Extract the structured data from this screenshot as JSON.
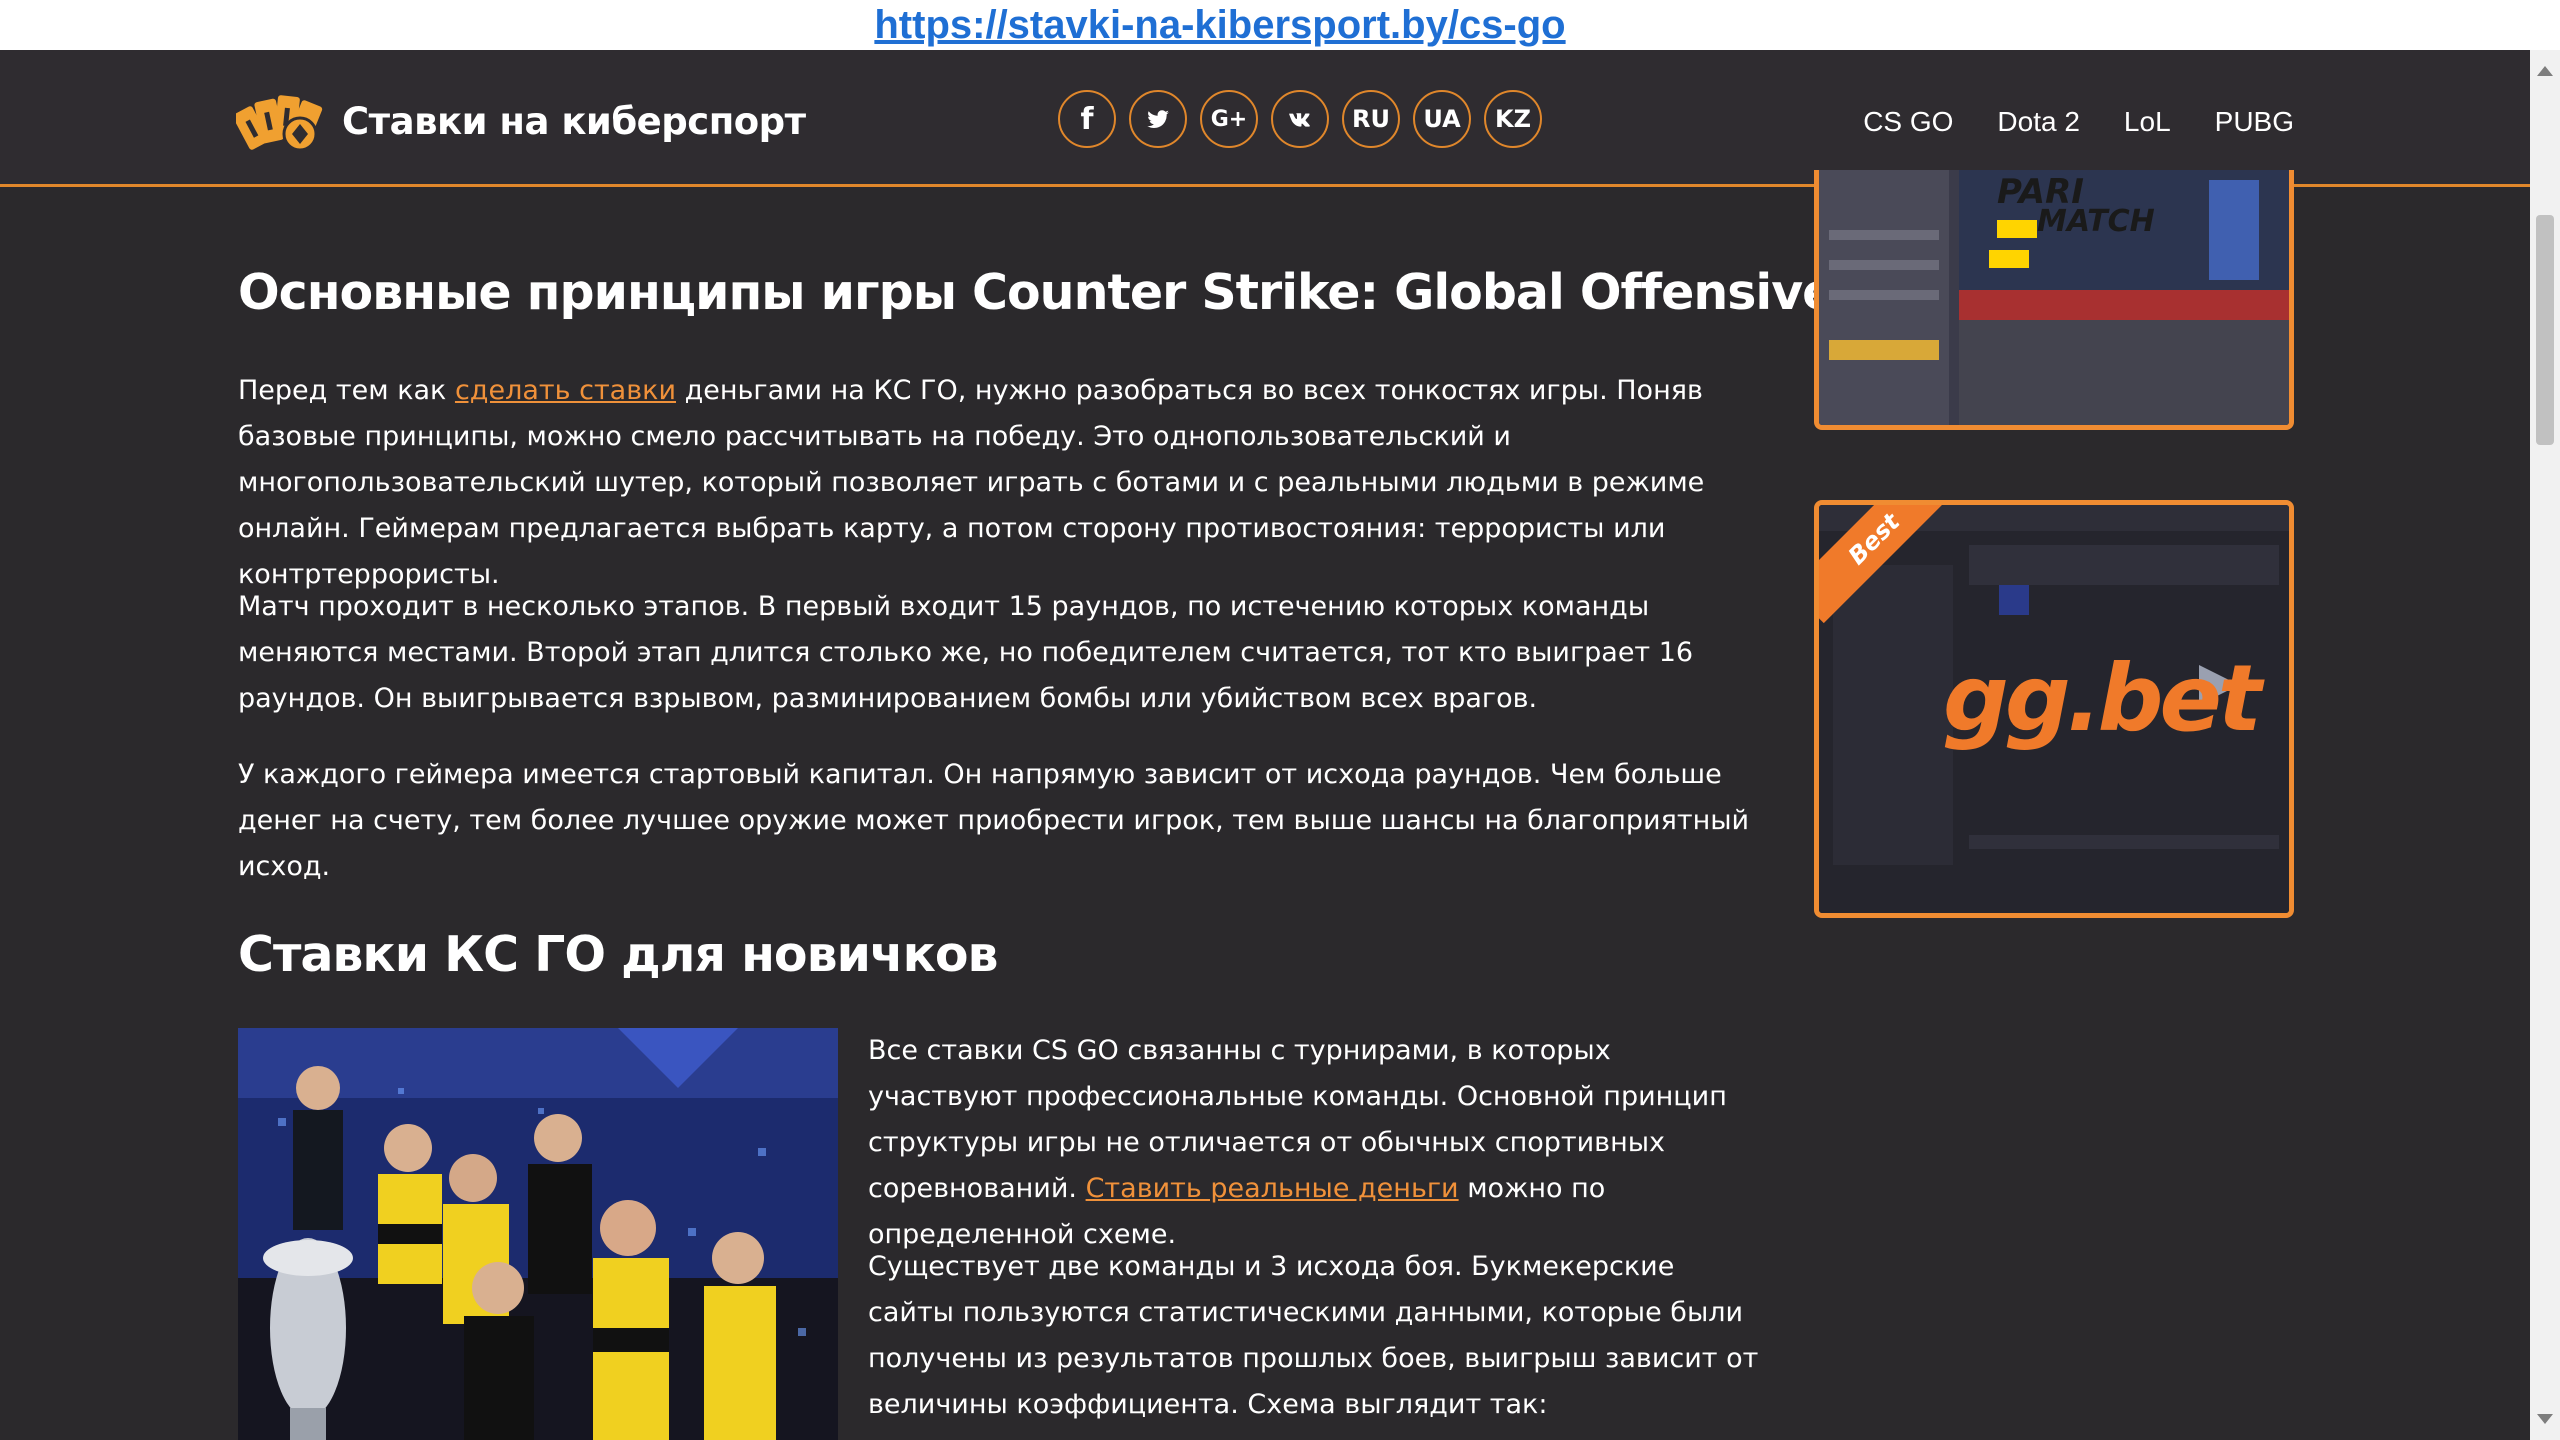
{
  "url_caption": "https://stavki-na-kibersport.by/cs-go",
  "header": {
    "site_name": "Ставки на киберспорт",
    "social": [
      "f",
      "twitter-bird",
      "G+",
      "vk"
    ],
    "languages": [
      "RU",
      "UA",
      "KZ"
    ],
    "nav": [
      "CS GO",
      "Dota 2",
      "LoL",
      "PUBG"
    ]
  },
  "article": {
    "heading1": "Основные принципы игры Counter Strike: Global Offensive",
    "p1_before": "Перед тем как ",
    "p1_link": "сделать ставки",
    "p1_after": " деньгами на КС ГО, нужно разобраться во всех тонкостях игры. Поняв базовые принципы, можно смело рассчитывать на победу. Это однопользовательский и многопользовательский шутер, который позволяет играть с ботами и с реальными людьми в режиме онлайн. Геймерам предлагается выбрать карту, а потом сторону противостояния: террористы или контртеррористы.",
    "p2": "Матч проходит в несколько этапов. В первый входит 15 раундов, по истечению которых команды меняются местами. Второй этап длится столько же, но победителем считается, тот кто выиграет 16 раундов. Он выигрывается взрывом, разминированием бомбы или убийством всех врагов.",
    "p3": "У каждого геймера имеется стартовый капитал. Он напрямую зависит от исхода раундов. Чем больше денег на счету, тем более лучшее оружие может приобрести игрок, тем выше шансы на благоприятный исход.",
    "heading2": "Ставки КС ГО для новичков",
    "s1_before": "Все ставки CS GO связанны с турнирами, в которых участвуют профессиональные команды. Основной принцип структуры игры не отличается от обычных спортивных соревнований. ",
    "s1_link": "Ставить реальные деньги",
    "s1_after": " можно по определенной схеме.",
    "s2": "Существует две команды и 3 исхода боя. Букмекерские сайты пользуются статистическими данными, которые были получены из результатов прошлых боев, выигрыш зависит от величины коэффициента. Схема выглядит так:"
  },
  "sidebar": {
    "banner1_brand_top": "PARI",
    "banner1_brand_bottom": "MATCH",
    "banner2_ribbon": "Best",
    "banner2_brand": "gg.bet"
  },
  "colors": {
    "accent": "#f08c32",
    "background": "#2b292c",
    "link": "#1f6fd4"
  }
}
